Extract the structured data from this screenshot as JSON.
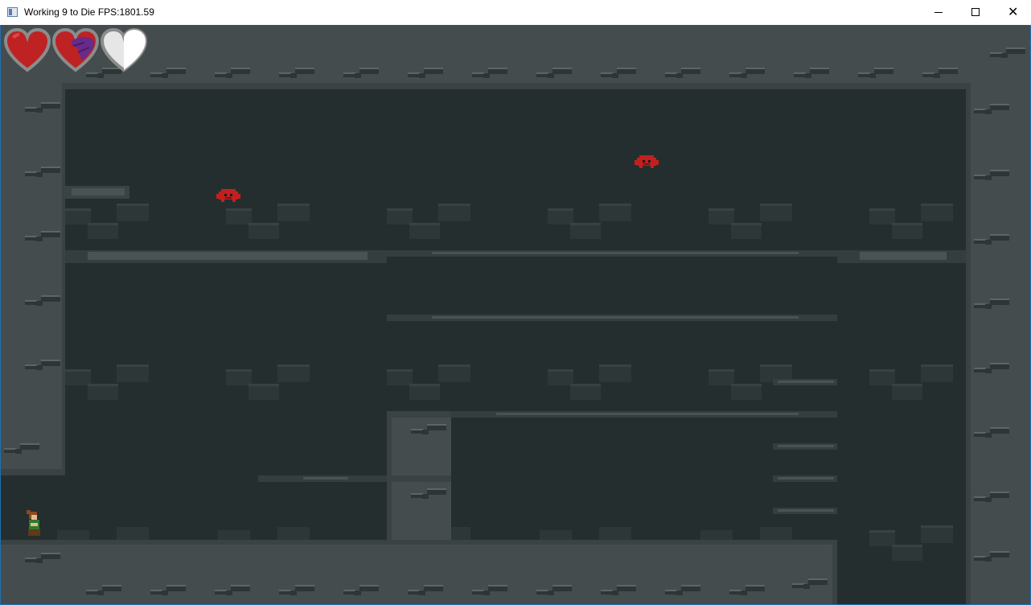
{
  "window": {
    "title": "Working 9 to Die FPS:1801.59",
    "minimize_icon": "minimize-icon",
    "maximize_icon": "maximize-icon",
    "close_icon": "close-icon",
    "close_glyph": "✕"
  },
  "hud": {
    "hearts": [
      {
        "state": "full",
        "icon": "heart-icon"
      },
      {
        "state": "cursed",
        "icon": "heart-icon"
      },
      {
        "state": "empty",
        "icon": "heart-icon"
      }
    ]
  },
  "colors": {
    "background": "#242e2e",
    "wall": "#444c4d",
    "wall_dark": "#3a4243",
    "platform": "#353e3f",
    "platform_highlight": "#4a5354",
    "brick_dark": "#2d3737",
    "brick_light": "#3c4647",
    "heart_red": "#bf2222",
    "heart_purple": "#6a2a8a",
    "heart_empty": "#e6e6e6",
    "heart_border": "#8c8c8c",
    "enemy": "#c41f1f"
  },
  "entities": {
    "player": "office-worker",
    "enemies": [
      "red-crab",
      "red-crab"
    ]
  }
}
